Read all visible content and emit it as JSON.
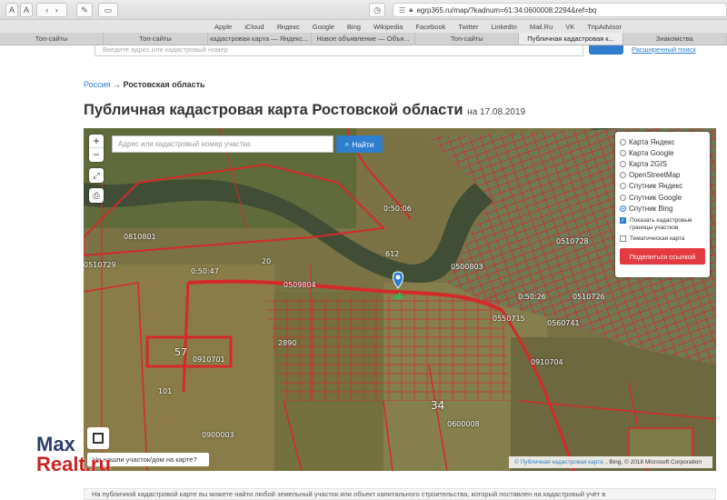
{
  "browser": {
    "url": "egrp365.ru/map/?kadnum=61:34:0600008:2294&ref=bq",
    "reader_button": "A",
    "reader_small": "A",
    "favorites": [
      "Apple",
      "iCloud",
      "Яндекс",
      "Google",
      "Bing",
      "Wikipedia",
      "Facebook",
      "Twitter",
      "LinkedIn",
      "Mail.Ru",
      "VK",
      "TripAdvisor"
    ],
    "tabs": [
      {
        "label": "Топ-сайты",
        "active": false
      },
      {
        "label": "Топ-сайты",
        "active": false
      },
      {
        "label": "кадастровая карта — Яндекс...",
        "active": false
      },
      {
        "label": "Новое объявление — Объя...",
        "active": false
      },
      {
        "label": "Топ-сайты",
        "active": false
      },
      {
        "label": "Публичная кадастровая к...",
        "active": true
      },
      {
        "label": "Знакомства",
        "active": false
      }
    ]
  },
  "header": {
    "search_placeholder": "Введите адрес или кадастровый номер",
    "extended_search": "Расширенный поиск"
  },
  "breadcrumb": {
    "root": "Россия",
    "arrow": "→",
    "current": "Ростовская область"
  },
  "title": {
    "main": "Публичная кадастровая карта Ростовской области",
    "date": "на 17.08.2019"
  },
  "map": {
    "zoom_in": "+",
    "zoom_out": "−",
    "search_placeholder": "Адрес или кадастровый номер участка",
    "find_button": "Найти",
    "layers": [
      {
        "label": "Карта Яндекс",
        "selected": false
      },
      {
        "label": "Карта Google",
        "selected": false
      },
      {
        "label": "Карта 2GIS",
        "selected": false
      },
      {
        "label": "OpenStreetMap",
        "selected": false
      },
      {
        "label": "Спутник Яндекс",
        "selected": false
      },
      {
        "label": "Спутник Google",
        "selected": false
      },
      {
        "label": "Спутник Bing",
        "selected": true
      }
    ],
    "show_borders_label": "Показать кадастровые границы участков",
    "show_borders_checked": true,
    "thematic_label": "Тематическая карта",
    "thematic_checked": false,
    "share_button": "Поделиться ссылкой",
    "question_button": "Не нашли участок/дом на карте?",
    "attribution_link": "© Публичная кадастровая карта",
    "attribution_rest": ", Bing, © 2018 Microsoft Corporation",
    "parcel_labels": [
      "0:50:47",
      "0509804",
      "0:50:06",
      "0500803",
      "0:50:26",
      "0560741",
      "0550715",
      "0510726",
      "0910704",
      "0600008",
      "57",
      "0910701",
      "34",
      "101",
      "20",
      "612",
      "2890",
      "0900003",
      "0510729",
      "0510728",
      "0810801"
    ]
  },
  "info_text": "На публичной кадастровой карте вы можете найти любой земельный участок или объект капитального строительства, который поставлен на кадастровый учёт в",
  "watermark": {
    "part1": "Max",
    "part2": "Realt.ru"
  },
  "colors": {
    "accent": "#2e7fcf",
    "share": "#e33b41",
    "parcel_border": "#d42a2a"
  }
}
